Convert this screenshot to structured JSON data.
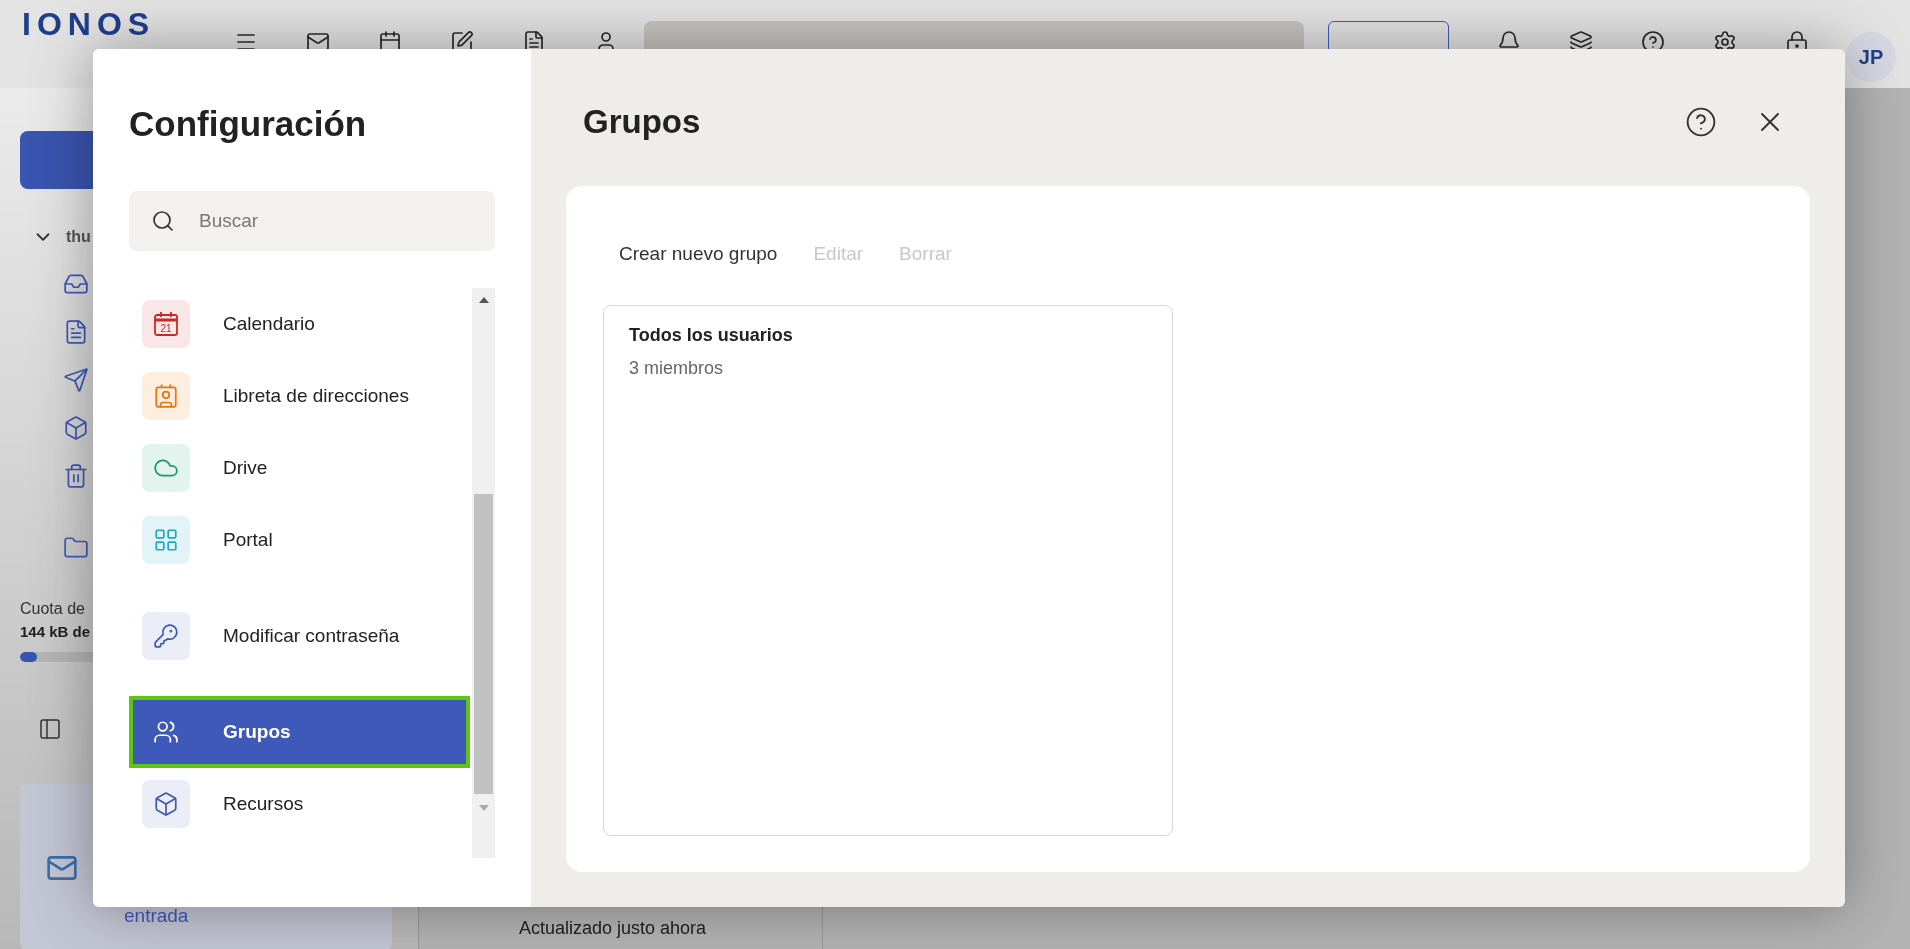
{
  "app": {
    "logo": "IONOS",
    "avatar": "JP",
    "folder_label": "thu",
    "quota_label": "Cuota de",
    "quota_value": "144 kB de",
    "quota": {
      "level": 0.07
    },
    "promo_text": "entrada",
    "status": "Actualizado justo ahora"
  },
  "settings": {
    "title": "Configuración",
    "search": {
      "placeholder": "Buscar"
    },
    "sections": [
      {
        "items": [
          {
            "label": "Calendario",
            "badge": "21",
            "selected": false
          },
          {
            "label": "Libreta de direcciones",
            "selected": false
          },
          {
            "label": "Drive",
            "selected": false
          },
          {
            "label": "Portal",
            "selected": false
          }
        ]
      },
      {
        "items": [
          {
            "label": "Modificar contraseña",
            "selected": false
          }
        ]
      },
      {
        "items": [
          {
            "label": "Grupos",
            "selected": true
          },
          {
            "label": "Recursos",
            "selected": false
          }
        ]
      }
    ]
  },
  "content": {
    "title": "Grupos",
    "toolbar": [
      {
        "label": "Crear nuevo grupo",
        "disabled": false
      },
      {
        "label": "Editar",
        "disabled": true
      },
      {
        "label": "Borrar",
        "disabled": true
      }
    ],
    "groups": [
      {
        "name": "Todos los usuarios",
        "members": "3 miembros"
      }
    ]
  }
}
